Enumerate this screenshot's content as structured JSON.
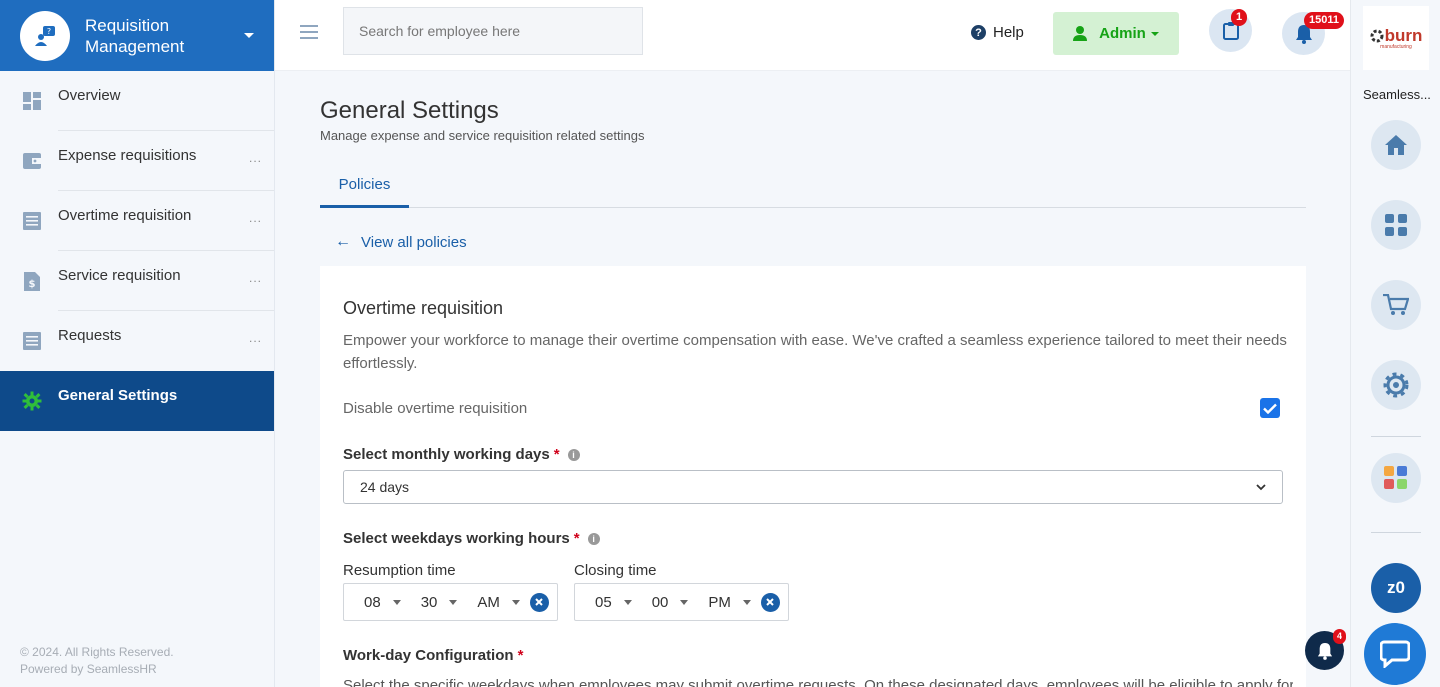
{
  "sidebar": {
    "brand_title": "Requisition Management",
    "items": [
      {
        "label": "Overview",
        "icon": "dashboard-icon",
        "dots": ""
      },
      {
        "label": "Expense requisitions",
        "icon": "wallet-icon",
        "dots": "..."
      },
      {
        "label": "Overtime requisition",
        "icon": "list-icon",
        "dots": "..."
      },
      {
        "label": "Service requisition",
        "icon": "dollar-document-icon",
        "dots": "..."
      },
      {
        "label": "Requests",
        "icon": "list-icon",
        "dots": "..."
      },
      {
        "label": "General Settings",
        "icon": "gear-icon",
        "dots": "",
        "active": true
      }
    ],
    "footer_line1": "© 2024. All Rights Reserved.",
    "footer_line2": "Powered by SeamlessHR"
  },
  "topbar": {
    "search_placeholder": "Search for employee here",
    "help_label": "Help",
    "admin_label": "Admin",
    "clipboard_badge": "1",
    "bell_badge": "15011"
  },
  "rail": {
    "logo_text": "burn",
    "logo_subtext": "manufacturing",
    "company_name": "Seamless...",
    "z0_label": "z0",
    "notif_badge": "4"
  },
  "main": {
    "title": "General Settings",
    "subtitle": "Manage expense and service requisition related settings",
    "tabs": [
      {
        "label": "Policies"
      }
    ],
    "back_link": "View all policies",
    "card": {
      "title": "Overtime requisition",
      "description": "Empower your workforce to manage their overtime compensation with ease. We've crafted a seamless experience tailored to meet their needs effortlessly.",
      "disable_label": "Disable overtime requisition",
      "disable_checked": true,
      "working_days_label": "Select monthly working days",
      "working_days_value": "24 days",
      "working_hours_label": "Select weekdays working hours",
      "resumption_label": "Resumption time",
      "resumption": {
        "hour": "08",
        "minute": "30",
        "ampm": "AM"
      },
      "closing_label": "Closing time",
      "closing": {
        "hour": "05",
        "minute": "00",
        "ampm": "PM"
      },
      "workday_label": "Work-day Configuration",
      "workday_desc": "Select the specific weekdays when employees may submit overtime requests. On these designated days, employees will be eligible to apply for extra"
    }
  },
  "colors": {
    "brand": "#1f6dbf",
    "active_nav": "#0e4a8a",
    "accent": "#1a5fa8",
    "admin_bg": "#d4f1d3",
    "admin_text": "#16a316",
    "badge": "#e0101a"
  }
}
